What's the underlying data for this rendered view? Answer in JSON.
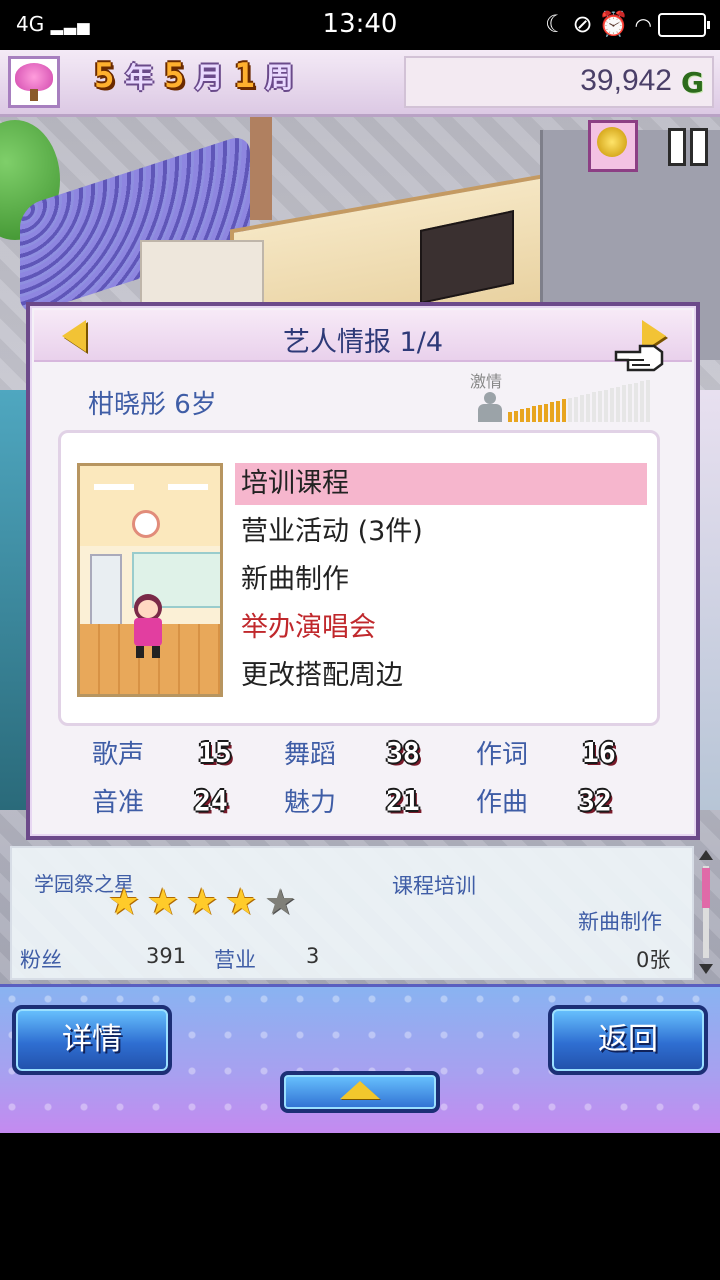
{
  "status_bar": {
    "network": "4G",
    "time": "13:40"
  },
  "hud": {
    "year_num": "5",
    "year_unit": "年",
    "month_num": "5",
    "month_unit": "月",
    "week_num": "1",
    "week_unit": "周",
    "money": "39,942",
    "currency": "G"
  },
  "dialog": {
    "title": "艺人情报 1/4",
    "artist_name": "柑晓彤 6岁",
    "passion_label": "激情",
    "passion_level": 0.4,
    "menu": [
      {
        "label": "培训课程",
        "selected": true
      },
      {
        "label": "营业活动 (3件)"
      },
      {
        "label": "新曲制作"
      },
      {
        "label": "举办演唱会",
        "highlight": "red"
      },
      {
        "label": "更改搭配周边"
      }
    ],
    "stats": [
      {
        "label": "歌声",
        "value": "15"
      },
      {
        "label": "舞蹈",
        "value": "38"
      },
      {
        "label": "作词",
        "value": "16"
      },
      {
        "label": "音准",
        "value": "24"
      },
      {
        "label": "魅力",
        "value": "21"
      },
      {
        "label": "作曲",
        "value": "32"
      }
    ]
  },
  "info": {
    "title_label": "学园祭之星",
    "stars_filled": 4,
    "stars_total": 5,
    "current_task": "课程培训",
    "next_task": "新曲制作",
    "fans_label": "粉丝",
    "fans_value": "391",
    "business_label": "营业",
    "business_value": "3",
    "records_value": "0张"
  },
  "buttons": {
    "details": "详情",
    "back": "返回"
  },
  "colors": {
    "selected_row": "#f6b6cd",
    "label_blue": "#3f5da6",
    "red_menu": "#c0282c",
    "button_blue": "#2f6fd2"
  }
}
